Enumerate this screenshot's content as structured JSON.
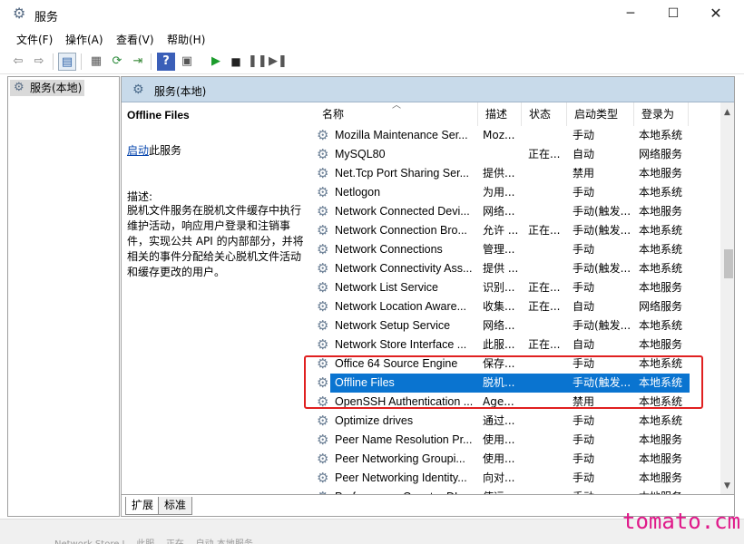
{
  "window": {
    "title": "服务",
    "app_icon": "gear-icon"
  },
  "menu": [
    "文件(F)",
    "操作(A)",
    "查看(V)",
    "帮助(H)"
  ],
  "toolbar": {
    "buttons": [
      "back-icon",
      "forward-icon",
      "show-hide-tree-icon",
      "properties-icon",
      "refresh-icon",
      "export-icon",
      "help-icon",
      "view-icon",
      "start-icon",
      "stop-icon",
      "pause-icon",
      "restart-icon"
    ]
  },
  "tree": {
    "item": "服务(本地)"
  },
  "header": {
    "title": "服务(本地)"
  },
  "details": {
    "service_name": "Offline Files",
    "start_link": "启动",
    "start_suffix": "此服务",
    "description_label": "描述:",
    "description": "脱机文件服务在脱机文件缓存中执行维护活动，响应用户登录和注销事件，实现公共 API 的内部部分，并将相关的事件分配给关心脱机文件活动和缓存更改的用户。"
  },
  "columns": [
    "名称",
    "描述",
    "状态",
    "启动类型",
    "登录为"
  ],
  "rows": [
    {
      "name": "Mozilla Maintenance Ser...",
      "desc": "Moz...",
      "status": "",
      "start": "手动",
      "logon": "本地系统"
    },
    {
      "name": "MySQL80",
      "desc": "",
      "status": "正在...",
      "start": "自动",
      "logon": "网络服务"
    },
    {
      "name": "Net.Tcp Port Sharing Ser...",
      "desc": "提供...",
      "status": "",
      "start": "禁用",
      "logon": "本地服务"
    },
    {
      "name": "Netlogon",
      "desc": "为用...",
      "status": "",
      "start": "手动",
      "logon": "本地系统"
    },
    {
      "name": "Network Connected Devi...",
      "desc": "网络...",
      "status": "",
      "start": "手动(触发...",
      "logon": "本地服务"
    },
    {
      "name": "Network Connection Bro...",
      "desc": "允许 ...",
      "status": "正在...",
      "start": "手动(触发...",
      "logon": "本地系统"
    },
    {
      "name": "Network Connections",
      "desc": "管理...",
      "status": "",
      "start": "手动",
      "logon": "本地系统"
    },
    {
      "name": "Network Connectivity Ass...",
      "desc": "提供 ...",
      "status": "",
      "start": "手动(触发...",
      "logon": "本地系统"
    },
    {
      "name": "Network List Service",
      "desc": "识别...",
      "status": "正在...",
      "start": "手动",
      "logon": "本地服务"
    },
    {
      "name": "Network Location Aware...",
      "desc": "收集...",
      "status": "正在...",
      "start": "自动",
      "logon": "网络服务"
    },
    {
      "name": "Network Setup Service",
      "desc": "网络...",
      "status": "",
      "start": "手动(触发...",
      "logon": "本地系统"
    },
    {
      "name": "Network Store Interface ...",
      "desc": "此服...",
      "status": "正在...",
      "start": "自动",
      "logon": "本地服务"
    },
    {
      "name": "Office 64 Source Engine",
      "desc": "保存...",
      "status": "",
      "start": "手动",
      "logon": "本地系统"
    },
    {
      "name": "Offline Files",
      "desc": "脱机...",
      "status": "",
      "start": "手动(触发...",
      "logon": "本地系统",
      "selected": true
    },
    {
      "name": "OpenSSH Authentication ...",
      "desc": "Age...",
      "status": "",
      "start": "禁用",
      "logon": "本地系统"
    },
    {
      "name": "Optimize drives",
      "desc": "通过...",
      "status": "",
      "start": "手动",
      "logon": "本地系统"
    },
    {
      "name": "Peer Name Resolution Pr...",
      "desc": "使用...",
      "status": "",
      "start": "手动",
      "logon": "本地服务"
    },
    {
      "name": "Peer Networking Groupi...",
      "desc": "使用...",
      "status": "",
      "start": "手动",
      "logon": "本地服务"
    },
    {
      "name": "Peer Networking Identity...",
      "desc": "向对...",
      "status": "",
      "start": "手动",
      "logon": "本地服务"
    },
    {
      "name": "Performance Counter DL...",
      "desc": "使远...",
      "status": "",
      "start": "手动",
      "logon": "本地服务"
    }
  ],
  "tabs": [
    "扩展",
    "标准"
  ],
  "statusbar": {
    "ghost_text": "Network Store I...   此服...   正在...   自动   本地服务"
  },
  "watermark": "tomato.cm",
  "colors": {
    "selection": "#0a74d0",
    "highlight_border": "#e02020",
    "header_bg": "#c8daea",
    "watermark": "#e0198a"
  }
}
